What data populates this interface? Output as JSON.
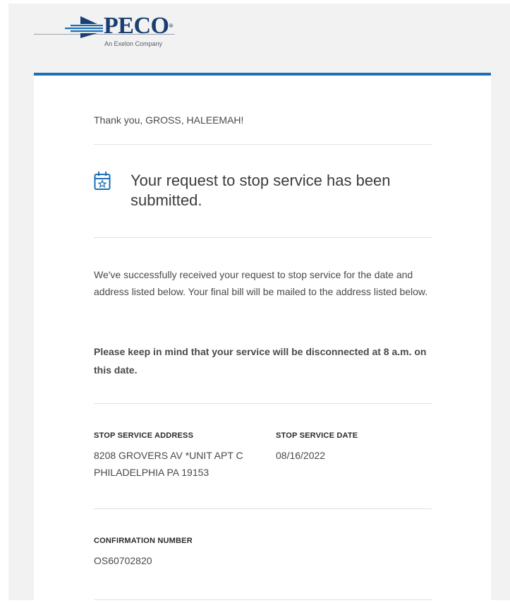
{
  "brand": {
    "name": "PECO",
    "registered_mark": "®",
    "tagline": "An Exelon Company",
    "primary_color": "#1a3e72",
    "accent_color": "#1c6fb6"
  },
  "message": {
    "greeting": "Thank you, GROSS, HALEEMAH!",
    "headline_icon": "calendar-star-icon",
    "headline": "Your request to stop service has been submitted.",
    "body": "We've successfully received your request to stop service for the date and address listed below. Your final bill will be mailed to the address listed below.",
    "note": "Please keep in mind that your service will be disconnected at 8 a.m. on this date."
  },
  "details": {
    "address_label": "STOP SERVICE ADDRESS",
    "address_value": "8208 GROVERS AV *UNIT APT C PHILADELPHIA PA 19153",
    "date_label": "STOP SERVICE DATE",
    "date_value": "08/16/2022",
    "confirmation_label": "CONFIRMATION NUMBER",
    "confirmation_value": "OS60702820"
  }
}
